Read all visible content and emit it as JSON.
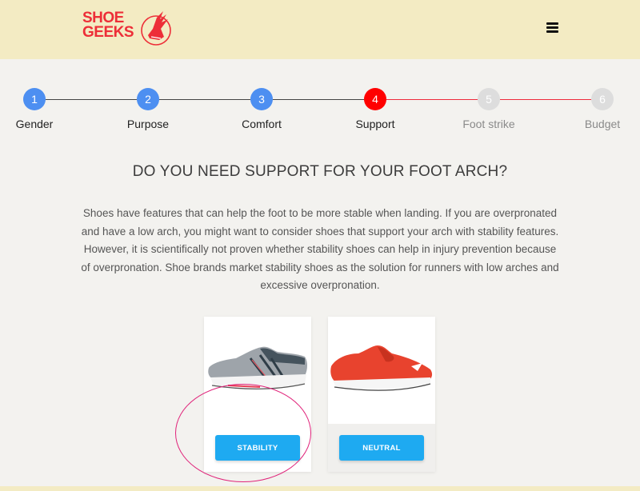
{
  "header": {
    "logo_line1": "SHOE",
    "logo_line2": "GEEKS",
    "logo_icon": "winged-shoe-icon",
    "menu_icon": "hamburger-menu-icon",
    "brand_color": "#ed2e38",
    "background_color": "#f3ebc3"
  },
  "stepper": {
    "current_step": 4,
    "steps": [
      {
        "number": "1",
        "label": "Gender",
        "status": "done"
      },
      {
        "number": "2",
        "label": "Purpose",
        "status": "done"
      },
      {
        "number": "3",
        "label": "Comfort",
        "status": "done"
      },
      {
        "number": "4",
        "label": "Support",
        "status": "active"
      },
      {
        "number": "5",
        "label": "Foot strike",
        "status": "upcoming"
      },
      {
        "number": "6",
        "label": "Budget",
        "status": "upcoming"
      }
    ],
    "colors": {
      "done": "#4d8ff1",
      "active": "#ff0000",
      "upcoming": "#dddddd"
    }
  },
  "question": {
    "title": "DO YOU NEED SUPPORT FOR YOUR FOOT ARCH?",
    "description": "Shoes have features that can help the foot to be more stable when landing. If you are overpronated and have a low arch, you might want to consider shoes that support your arch with stability features. However, it is scientifically not proven whether stability shoes can help in injury prevention because of overpronation. Shoe brands market stability shoes as the solution for runners with low arches and excessive overpronation."
  },
  "options": [
    {
      "label": "STABILITY",
      "image": "grey-stability-running-shoe",
      "highlighted": true
    },
    {
      "label": "NEUTRAL",
      "image": "red-neutral-running-shoe",
      "highlighted": false
    }
  ],
  "button_color": "#1eaaf1",
  "highlight_color": "#e0237a"
}
